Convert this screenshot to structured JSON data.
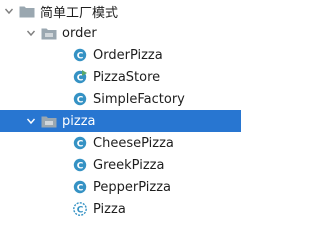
{
  "tree": {
    "root": {
      "label": "简单工厂模式",
      "icon": "folder-icon",
      "expanded": true
    },
    "order": {
      "label": "order",
      "icon": "package-folder-icon",
      "expanded": true,
      "items": [
        {
          "label": "OrderPizza",
          "icon": "class-icon"
        },
        {
          "label": "PizzaStore",
          "icon": "runnable-class-icon"
        },
        {
          "label": "SimpleFactory",
          "icon": "class-icon"
        }
      ]
    },
    "pizza": {
      "label": "pizza",
      "icon": "package-folder-icon",
      "expanded": true,
      "selected": true,
      "items": [
        {
          "label": "CheesePizza",
          "icon": "class-icon"
        },
        {
          "label": "GreekPizza",
          "icon": "class-icon"
        },
        {
          "label": "PepperPizza",
          "icon": "class-icon"
        },
        {
          "label": "Pizza",
          "icon": "abstract-class-icon"
        }
      ]
    }
  },
  "colors": {
    "selection": "#2876d1",
    "class_icon": "#3592c4",
    "folder": "#9aa7b0",
    "run_marker": "#59a869"
  }
}
